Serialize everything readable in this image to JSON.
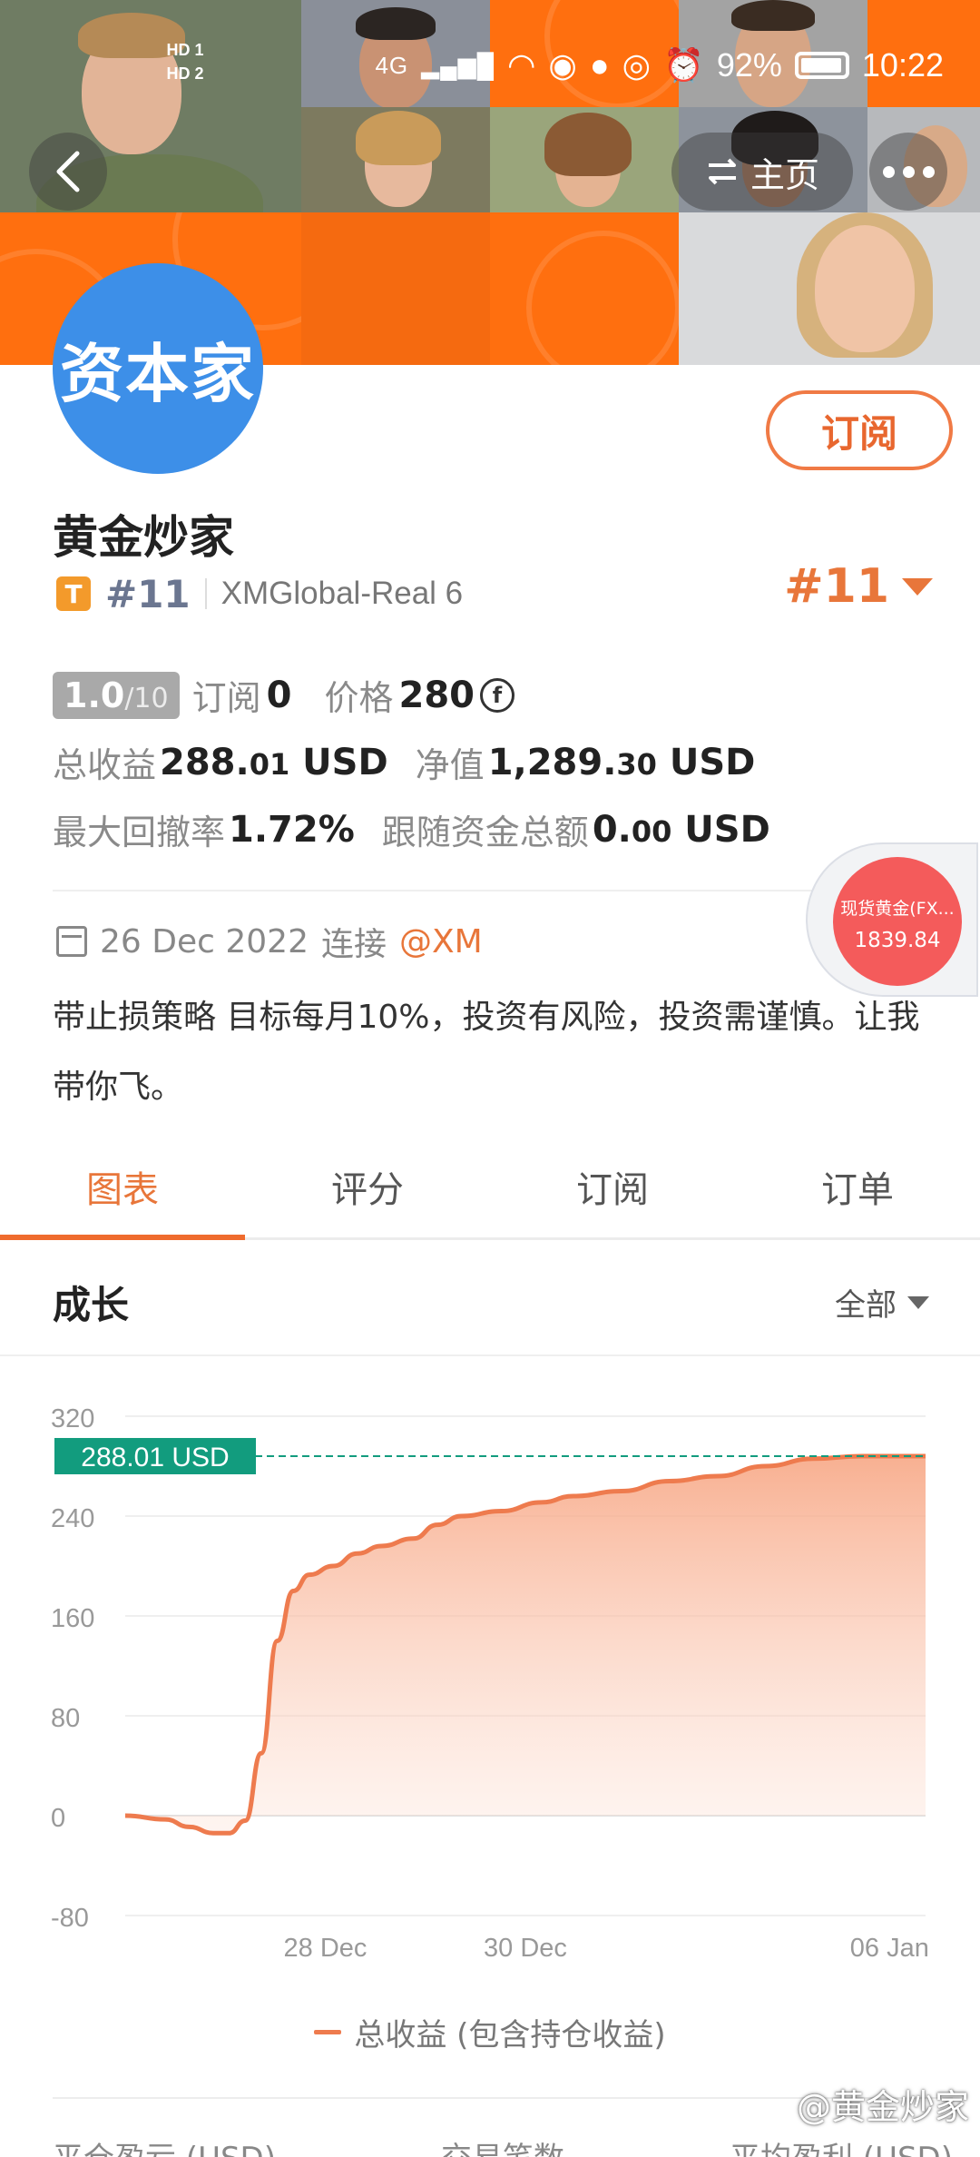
{
  "status_bar": {
    "hd1": "HD 1",
    "hd2": "HD 2",
    "signal": "4G",
    "battery": "92%",
    "time": "10:22"
  },
  "header": {
    "home_label": "主页",
    "avatar_text": "资本家",
    "subscribe_label": "订阅"
  },
  "profile": {
    "name": "黄金炒家",
    "badge": "T",
    "rank_small": "#11",
    "account": "XMGlobal-Real 6",
    "rank_big": "#11",
    "score": "1.0",
    "score_den": "/10",
    "subscribe_label": "订阅",
    "subscribe_count": "0",
    "price_label": "价格",
    "price_value": "280",
    "total_profit_label": "总收益",
    "total_profit_int": "288.",
    "total_profit_dec": "01",
    "total_profit_unit": " USD",
    "equity_label": "净值",
    "equity_int": "1,289.",
    "equity_dec": "30",
    "equity_unit": " USD",
    "drawdown_label": "最大回撤率",
    "drawdown_value": "1.72%",
    "follow_label": "跟随资金总额",
    "follow_int": "0.",
    "follow_dec": "00",
    "follow_unit": " USD",
    "date": "26 Dec 2022",
    "connect_label": "连接",
    "broker": "@XM",
    "bio": "带止损策略 目标每月10%，投资有风险，投资需谨慎。让我带你飞。"
  },
  "float_quote": {
    "name": "现货黄金(FX...",
    "price": "1839.84"
  },
  "tabs": [
    {
      "label": "图表",
      "active": true
    },
    {
      "label": "评分",
      "active": false
    },
    {
      "label": "订阅",
      "active": false
    },
    {
      "label": "订单",
      "active": false
    }
  ],
  "growth": {
    "title": "成长",
    "range": "全部"
  },
  "chart_data": {
    "type": "area",
    "y_ticks": [
      "320",
      "240",
      "160",
      "80",
      "0",
      "-80"
    ],
    "ylim": [
      -80,
      320
    ],
    "x_ticks": [
      "28 Dec",
      "30 Dec",
      "06 Jan"
    ],
    "marker_label": "288.01 USD",
    "marker_value": 288.01,
    "series": [
      {
        "name": "总收益 (包含持仓收益)",
        "color": "#ee7b4e",
        "points": [
          [
            0,
            0
          ],
          [
            0.05,
            -3
          ],
          [
            0.08,
            -9
          ],
          [
            0.11,
            -14
          ],
          [
            0.13,
            -14
          ],
          [
            0.15,
            -4
          ],
          [
            0.17,
            50
          ],
          [
            0.19,
            140
          ],
          [
            0.21,
            180
          ],
          [
            0.23,
            193
          ],
          [
            0.26,
            200
          ],
          [
            0.29,
            210
          ],
          [
            0.32,
            216
          ],
          [
            0.36,
            222
          ],
          [
            0.39,
            233
          ],
          [
            0.42,
            240
          ],
          [
            0.47,
            244
          ],
          [
            0.52,
            251
          ],
          [
            0.56,
            256
          ],
          [
            0.62,
            260
          ],
          [
            0.68,
            268
          ],
          [
            0.74,
            272
          ],
          [
            0.8,
            280
          ],
          [
            0.86,
            286
          ],
          [
            0.92,
            288
          ],
          [
            1.0,
            288.01
          ]
        ]
      }
    ],
    "legend": "总收益 (包含持仓收益)"
  },
  "footer": {
    "col1": "平仓盈亏 (USD)",
    "col2": "交易笔数",
    "col3": "平均盈利 (USD)"
  },
  "watermark": "@黄金炒家",
  "colors": {
    "accent": "#e8763a",
    "avatar_bg": "#3d8fe8",
    "marker_bg": "#129c7e",
    "quote_bubble": "#f45b5b"
  }
}
